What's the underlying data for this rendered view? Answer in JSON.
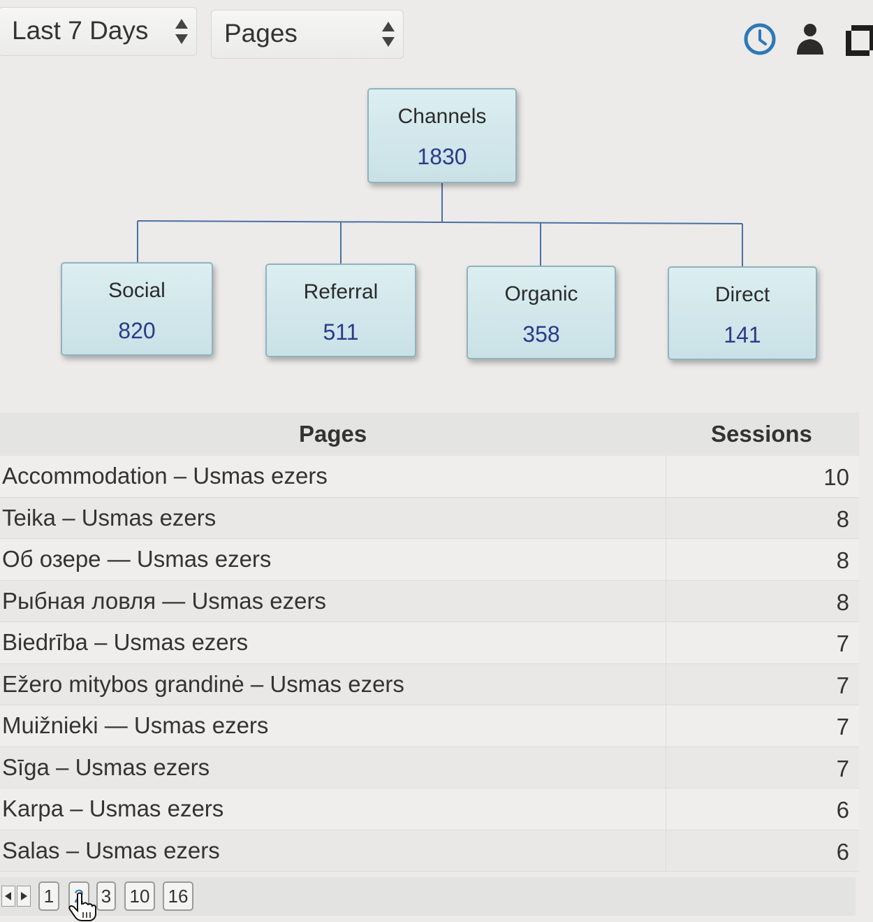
{
  "filters": {
    "date_range": "Last 7 Days",
    "dimension": "Pages"
  },
  "toolbar": {
    "icons": [
      "clock-icon",
      "user-icon",
      "copy-icon"
    ],
    "accent_color": "#2f78b8"
  },
  "tree": {
    "root": {
      "label": "Channels",
      "value": "1830"
    },
    "children": [
      {
        "label": "Social",
        "value": "820"
      },
      {
        "label": "Referral",
        "value": "511"
      },
      {
        "label": "Organic",
        "value": "358"
      },
      {
        "label": "Direct",
        "value": "141"
      }
    ]
  },
  "table": {
    "columns": [
      "Pages",
      "Sessions"
    ],
    "rows": [
      {
        "page": "Accommodation – Usmas ezers",
        "sessions": "10"
      },
      {
        "page": "Teika – Usmas ezers",
        "sessions": "8"
      },
      {
        "page": "Об озере — Usmas ezers",
        "sessions": "8"
      },
      {
        "page": "Рыбная ловля — Usmas ezers",
        "sessions": "8"
      },
      {
        "page": "Biedrība – Usmas ezers",
        "sessions": "7"
      },
      {
        "page": "Ežero mitybos grandinė – Usmas ezers",
        "sessions": "7"
      },
      {
        "page": "Muižnieki — Usmas ezers",
        "sessions": "7"
      },
      {
        "page": "Sīga – Usmas ezers",
        "sessions": "7"
      },
      {
        "page": "Karpa – Usmas ezers",
        "sessions": "6"
      },
      {
        "page": "Salas – Usmas ezers",
        "sessions": "6"
      }
    ]
  },
  "pagination": {
    "pages": [
      "1",
      "2",
      "3",
      "10",
      "16"
    ],
    "current": "2"
  }
}
